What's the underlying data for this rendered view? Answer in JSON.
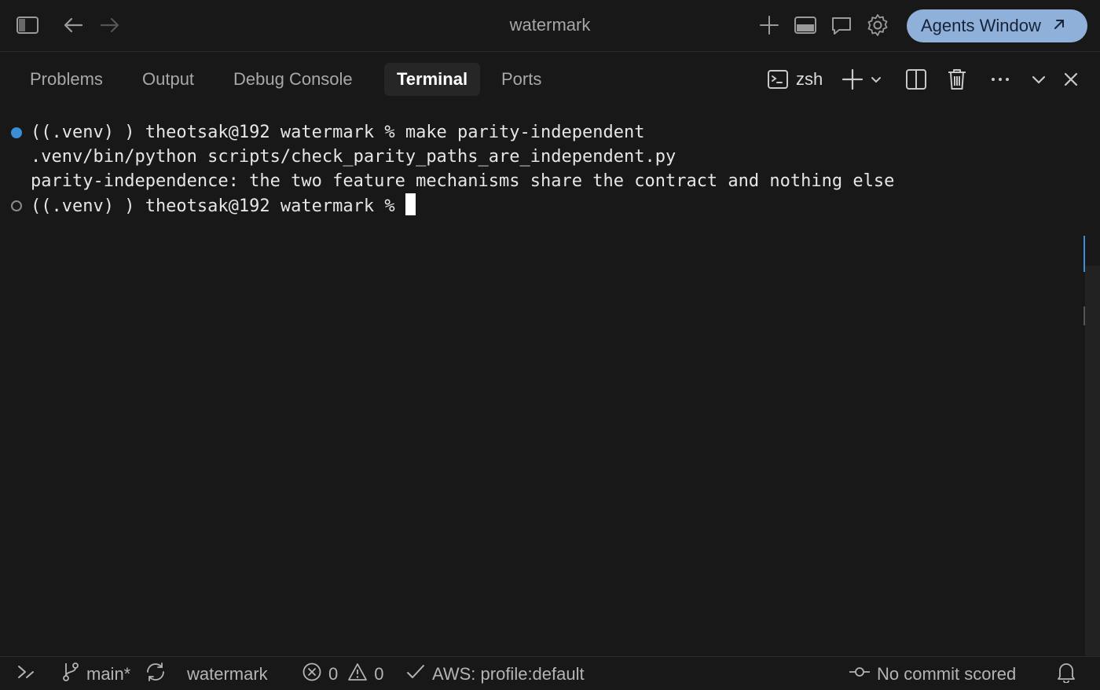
{
  "window": {
    "title": "watermark",
    "agents_button": "Agents Window"
  },
  "icons": {
    "toggle_sidebar": "sidebar-toggle-icon",
    "back": "arrow-left-icon",
    "forward": "arrow-right-icon",
    "new": "plus-icon",
    "panel": "panel-icon",
    "chat": "chat-icon",
    "settings": "gear-icon"
  },
  "panel": {
    "tabs": [
      {
        "label": "Problems",
        "active": false
      },
      {
        "label": "Output",
        "active": false
      },
      {
        "label": "Debug Console",
        "active": false
      },
      {
        "label": "Terminal",
        "active": true
      },
      {
        "label": "Ports",
        "active": false
      }
    ],
    "shell_label": "zsh"
  },
  "terminal": {
    "lines": [
      "((.venv) ) theotsak@192 watermark % make parity-independent",
      ".venv/bin/python scripts/check_parity_paths_are_independent.py",
      "parity-independence: the two feature mechanisms share the contract and nothing else",
      "((.venv) ) theotsak@192 watermark % "
    ]
  },
  "statusbar": {
    "branch": "main*",
    "folder": "watermark",
    "errors": "0",
    "warnings": "0",
    "aws": "AWS: profile:default",
    "commit": "No commit scored"
  },
  "colors": {
    "background": "#181818",
    "accent": "#3b8ed6",
    "agents_button": "#8fb0d9"
  }
}
